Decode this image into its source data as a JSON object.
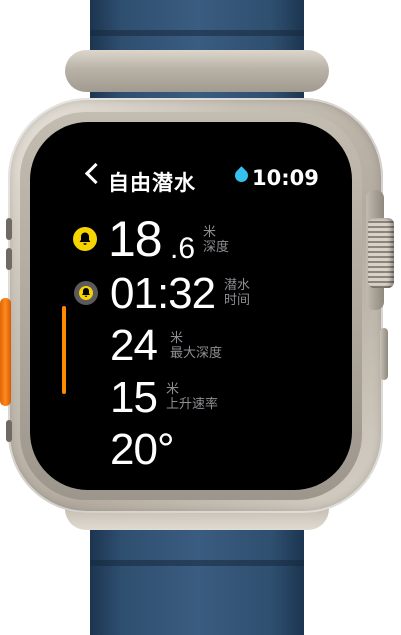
{
  "status": {
    "back_title": "自由潜水",
    "time": "10:09"
  },
  "metrics": {
    "depth": {
      "integer": "18",
      "decimal": ".6",
      "unit": "米",
      "label": "深度"
    },
    "dive_time": {
      "value": "01:32",
      "label_line1": "潜水",
      "label_line2": "时间"
    },
    "max_depth": {
      "value": "24",
      "unit": "米",
      "label": "最大深度"
    },
    "ascent_rate": {
      "value": "15",
      "unit": "米",
      "label": "上升速率"
    },
    "temperature": {
      "value": "20°"
    }
  },
  "colors": {
    "alarm_active": "#f6d400",
    "alarm_inactive": "#5a5a5e",
    "depth_indicator": "#ff8a00",
    "water_lock": "#35c0ee"
  },
  "icons": [
    "chevron-left-icon",
    "droplet-icon",
    "bell-icon"
  ]
}
